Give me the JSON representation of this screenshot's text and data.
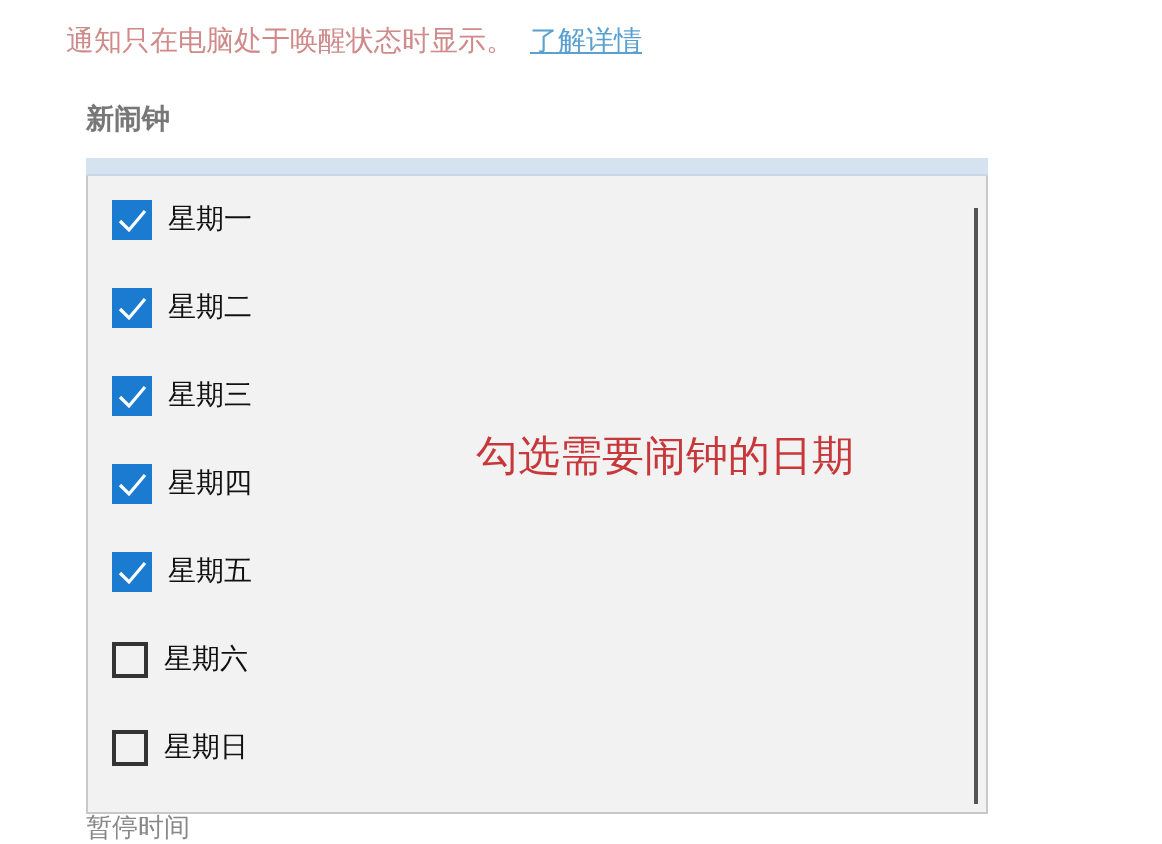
{
  "notice": {
    "text": "通知只在电脑处于唤醒状态时显示。",
    "link": "了解详情"
  },
  "section_title": "新闹钟",
  "days": [
    {
      "label": "星期一",
      "checked": true
    },
    {
      "label": "星期二",
      "checked": true
    },
    {
      "label": "星期三",
      "checked": true
    },
    {
      "label": "星期四",
      "checked": true
    },
    {
      "label": "星期五",
      "checked": true
    },
    {
      "label": "星期六",
      "checked": false
    },
    {
      "label": "星期日",
      "checked": false
    }
  ],
  "annotation": "勾选需要闹钟的日期",
  "next_section_title": "暂停时间"
}
